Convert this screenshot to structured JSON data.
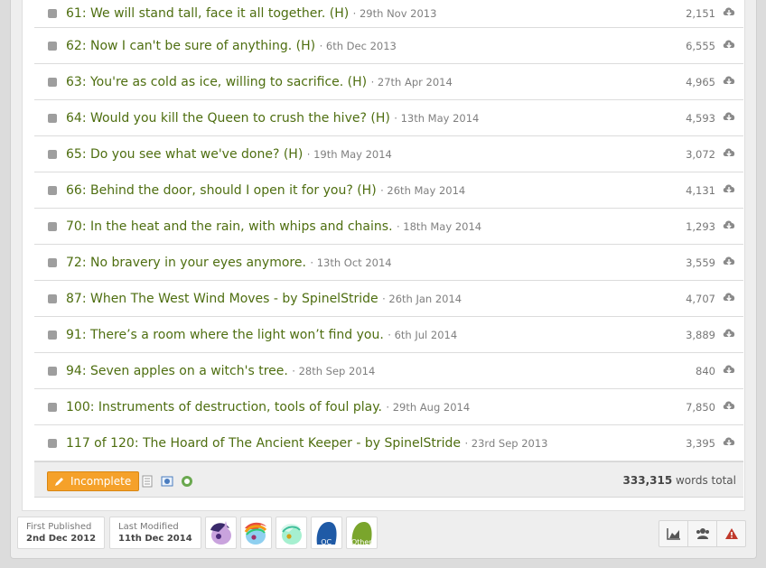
{
  "chapters": [
    {
      "title": "61: We will stand tall, face it all together. (H)",
      "date": "29th Nov 2013",
      "words": "2,151"
    },
    {
      "title": "62: Now I can't be sure of anything. (H)",
      "date": "6th Dec 2013",
      "words": "6,555"
    },
    {
      "title": "63: You're as cold as ice, willing to sacrifice. (H)",
      "date": "27th Apr 2014",
      "words": "4,965"
    },
    {
      "title": "64: Would you kill the Queen to crush the hive? (H)",
      "date": "13th May 2014",
      "words": "4,593"
    },
    {
      "title": "65: Do you see what we've done? (H)",
      "date": "19th May 2014",
      "words": "3,072"
    },
    {
      "title": "66: Behind the door, should I open it for you? (H)",
      "date": "26th May 2014",
      "words": "4,131"
    },
    {
      "title": "70: In the heat and the rain, with whips and chains.",
      "date": "18th May 2014",
      "words": "1,293"
    },
    {
      "title": "72: No bravery in your eyes anymore.",
      "date": "13th Oct 2014",
      "words": "3,559"
    },
    {
      "title": "87: When The West Wind Moves - by SpinelStride",
      "date": "26th Jan 2014",
      "words": "4,707"
    },
    {
      "title": "91: There’s a room where the light won’t find you.",
      "date": "6th Jul 2014",
      "words": "3,889"
    },
    {
      "title": "94: Seven apples on a witch's tree.",
      "date": "28th Sep 2014",
      "words": "840"
    },
    {
      "title": "100: Instruments of destruction, tools of foul play.",
      "date": "29th Aug 2014",
      "words": "7,850"
    },
    {
      "title": "117 of 120: The Hoard of The Ancient Keeper - by SpinelStride",
      "date": "23rd Sep 2013",
      "words": "3,395"
    }
  ],
  "date_prefix": "· ",
  "status": {
    "label": "Incomplete",
    "color": "#f5a12a"
  },
  "total": {
    "number": "333,315",
    "suffix": " words total"
  },
  "meta": {
    "first_published_label": "First Published",
    "first_published_value": "2nd Dec 2012",
    "last_modified_label": "Last Modified",
    "last_modified_value": "11th Dec 2014"
  },
  "characters": [
    {
      "name": "twilight-sparkle",
      "label": ""
    },
    {
      "name": "rainbow-dash",
      "label": ""
    },
    {
      "name": "lyra",
      "label": ""
    },
    {
      "name": "oc",
      "label": "OC"
    },
    {
      "name": "other",
      "label": "Other"
    }
  ],
  "icons": {
    "download": "cloud-download-icon",
    "status": "pencil-icon",
    "stats": "area-chart-icon",
    "group": "users-icon",
    "report": "warning-icon"
  },
  "colors": {
    "title": "#4e6e10",
    "accent": "#f5a12a",
    "report": "#c0392b"
  }
}
